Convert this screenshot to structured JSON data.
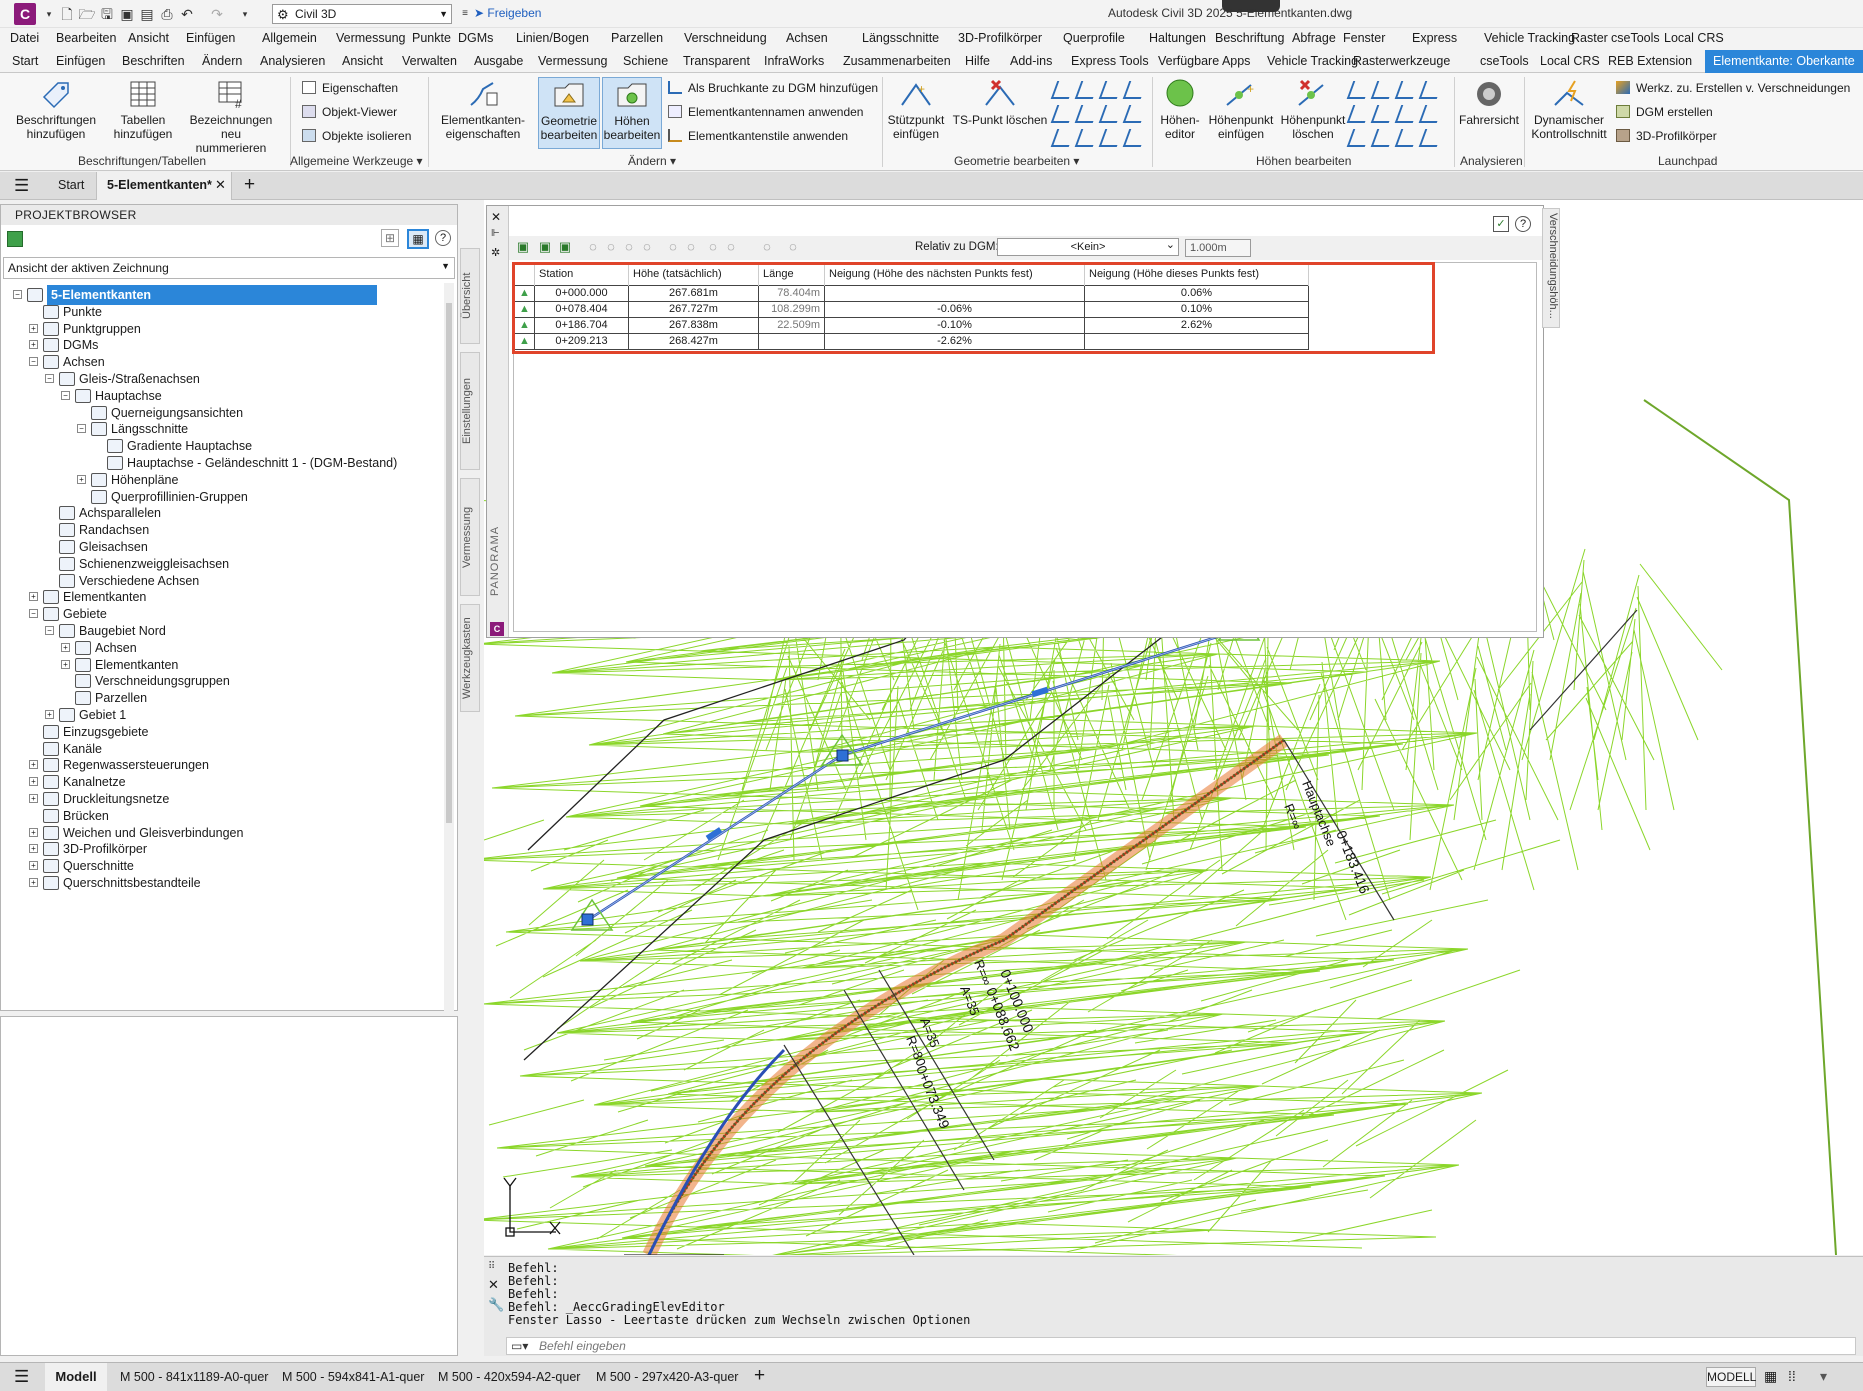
{
  "titlebar": {
    "workspace": "Civil 3D",
    "share": "Freigeben",
    "title": "Autodesk Civil 3D 2025   5-Elementkanten.dwg"
  },
  "menu": [
    "Datei",
    "Bearbeiten",
    "Ansicht",
    "Einfügen",
    "Allgemein",
    "Vermessung",
    "Punkte",
    "DGMs",
    "Linien/Bogen",
    "Parzellen",
    "Verschneidung",
    "Achsen",
    "Längsschnitte",
    "3D-Profilkörper",
    "Querprofile",
    "Haltungen",
    "Beschriftung",
    "Abfrage",
    "Fenster",
    "Express",
    "Vehicle Tracking",
    "Raster",
    "cseTools",
    "Local CRS"
  ],
  "ribbon_tabs": [
    "Start",
    "Einfügen",
    "Beschriften",
    "Ändern",
    "Analysieren",
    "Ansicht",
    "Verwalten",
    "Ausgabe",
    "Vermessung",
    "Schiene",
    "Transparent",
    "InfraWorks",
    "Zusammenarbeiten",
    "Hilfe",
    "Add-ins",
    "Express Tools",
    "Verfügbare Apps",
    "Vehicle Tracking",
    "Rasterwerkzeuge",
    "cseTools",
    "Local CRS",
    "REB Extension"
  ],
  "ribbon_active_tab": "Elementkante: Oberkante",
  "ribbon": {
    "beschriftungen": "Beschriftungen hinzufügen",
    "tabellen": "Tabellen hinzufügen",
    "bezeichnungen": "Bezeichnungen neu nummerieren",
    "panel1": "Beschriftungen/Tabellen",
    "eigenschaften": "Eigenschaften",
    "objektviewer": "Objekt-Viewer",
    "objekteisolieren": "Objekte isolieren",
    "panel2": "Allgemeine Werkzeuge",
    "ekeigen": "Elementkanten-eigenschaften",
    "geometrie": "Geometrie bearbeiten",
    "hoehen": "Höhen bearbeiten",
    "bruchkante": "Als Bruchkante zu DGM hinzufügen",
    "ekname": "Elementkantennamen anwenden",
    "ekstil": "Elementkantenstile anwenden",
    "panel3": "Ändern",
    "stuetzpunkt": "Stützpunkt einfügen",
    "tsloeschen": "TS-Punkt löschen",
    "panel4": "Geometrie bearbeiten",
    "hoeheneditor": "Höhen-editor",
    "hoehenpunkt": "Höhenpunkt einfügen",
    "hoehenpunktloeschen": "Höhenpunkt löschen",
    "panel5": "Höhen bearbeiten",
    "fahrersicht": "Fahrersicht",
    "panel6": "Analysieren",
    "dynkontroll": "Dynamischer Kontrollschnitt",
    "werkzverschn": "Werkz. zu. Erstellen v. Verschneidungen",
    "dgmerstellen": "DGM erstellen",
    "profilkoerper": "3D-Profilkörper",
    "panel7": "Launchpad"
  },
  "filetabs": {
    "start": "Start",
    "active": "5-Elementkanten*"
  },
  "browser": {
    "title": "PROJEKTBROWSER",
    "view": "Ansicht der aktiven Zeichnung",
    "tree": [
      {
        "label": "5-Elementkanten",
        "level": 0,
        "ex": "-",
        "sel": true
      },
      {
        "label": "Punkte",
        "level": 1,
        "ex": ""
      },
      {
        "label": "Punktgruppen",
        "level": 1,
        "ex": "+"
      },
      {
        "label": "DGMs",
        "level": 1,
        "ex": "+"
      },
      {
        "label": "Achsen",
        "level": 1,
        "ex": "-"
      },
      {
        "label": "Gleis-/Straßenachsen",
        "level": 2,
        "ex": "-"
      },
      {
        "label": "Hauptachse",
        "level": 3,
        "ex": "-"
      },
      {
        "label": "Querneigungsansichten",
        "level": 4,
        "ex": ""
      },
      {
        "label": "Längsschnitte",
        "level": 4,
        "ex": "-"
      },
      {
        "label": "Gradiente Hauptachse",
        "level": 5,
        "ex": ""
      },
      {
        "label": "Hauptachse - Geländeschnitt 1 - (DGM-Bestand)",
        "level": 5,
        "ex": ""
      },
      {
        "label": "Höhenpläne",
        "level": 4,
        "ex": "+"
      },
      {
        "label": "Querprofillinien-Gruppen",
        "level": 4,
        "ex": ""
      },
      {
        "label": "Achsparallelen",
        "level": 2,
        "ex": ""
      },
      {
        "label": "Randachsen",
        "level": 2,
        "ex": ""
      },
      {
        "label": "Gleisachsen",
        "level": 2,
        "ex": ""
      },
      {
        "label": "Schienenzweiggleisachsen",
        "level": 2,
        "ex": ""
      },
      {
        "label": "Verschiedene Achsen",
        "level": 2,
        "ex": ""
      },
      {
        "label": "Elementkanten",
        "level": 1,
        "ex": "+"
      },
      {
        "label": "Gebiete",
        "level": 1,
        "ex": "-"
      },
      {
        "label": "Baugebiet Nord",
        "level": 2,
        "ex": "-"
      },
      {
        "label": "Achsen",
        "level": 3,
        "ex": "+"
      },
      {
        "label": "Elementkanten",
        "level": 3,
        "ex": "+"
      },
      {
        "label": "Verschneidungsgruppen",
        "level": 3,
        "ex": ""
      },
      {
        "label": "Parzellen",
        "level": 3,
        "ex": ""
      },
      {
        "label": "Gebiet 1",
        "level": 2,
        "ex": "+"
      },
      {
        "label": "Einzugsgebiete",
        "level": 1,
        "ex": ""
      },
      {
        "label": "Kanäle",
        "level": 1,
        "ex": ""
      },
      {
        "label": "Regenwassersteuerungen",
        "level": 1,
        "ex": "+"
      },
      {
        "label": "Kanalnetze",
        "level": 1,
        "ex": "+"
      },
      {
        "label": "Druckleitungsnetze",
        "level": 1,
        "ex": "+"
      },
      {
        "label": "Brücken",
        "level": 1,
        "ex": ""
      },
      {
        "label": "Weichen und Gleisverbindungen",
        "level": 1,
        "ex": "+"
      },
      {
        "label": "3D-Profilkörper",
        "level": 1,
        "ex": "+"
      },
      {
        "label": "Querschnitte",
        "level": 1,
        "ex": "+"
      },
      {
        "label": "Querschnittsbestandteile",
        "level": 1,
        "ex": "+"
      }
    ]
  },
  "sidetabs": [
    "Übersicht",
    "Einstellungen",
    "Vermessung",
    "Werkzeugkasten"
  ],
  "panorama": {
    "side_label": "PANORAMA",
    "title_tab": "Verschneidungshöh...",
    "step": "1.000m",
    "rel_label": "Relativ zu DGM:",
    "rel_value": "<Kein>",
    "columns": [
      "Station",
      "Höhe (tatsächlich)",
      "Länge",
      "Neigung (Höhe des nächsten Punkts fest)",
      "Neigung (Höhe dieses Punkts fest)"
    ],
    "rows": [
      [
        "0+000.000",
        "267.681m",
        "78.404m",
        "",
        "0.06%"
      ],
      [
        "0+078.404",
        "267.727m",
        "108.299m",
        "-0.06%",
        "0.10%"
      ],
      [
        "0+186.704",
        "267.838m",
        "22.509m",
        "-0.10%",
        "2.62%"
      ],
      [
        "0+209.213",
        "268.427m",
        "",
        "-2.62%",
        ""
      ]
    ]
  },
  "drawing_labels": {
    "l1": "Hauptachse",
    "l2": "R=∞",
    "l3": "0+183.416",
    "l4": "0+100.000",
    "l5": "R=∞",
    "l6": "0+088.662",
    "l7": "A=35",
    "l8": "A=35",
    "l9": "R=80",
    "l10": "0+073.349"
  },
  "command": {
    "lines": [
      "Befehl:",
      "Befehl:",
      "Befehl:",
      "Befehl: _AeccGradingElevEditor",
      "Fenster Lasso - Leertaste drücken zum Wechseln zwischen Optionen"
    ],
    "placeholder": "Befehl eingeben"
  },
  "statusbar": {
    "model": "Modell",
    "layouts": [
      "M 500 - 841x1189-A0-quer",
      "M 500 - 594x841-A1-quer",
      "M 500 - 420x594-A2-quer",
      "M 500 - 297x420-A3-quer"
    ],
    "mode": "MODELL"
  },
  "colors": {
    "accent": "#2b86d9",
    "mesh": "#8bd62a",
    "highlight": "#e0442a",
    "line": "#2a4fb5"
  }
}
